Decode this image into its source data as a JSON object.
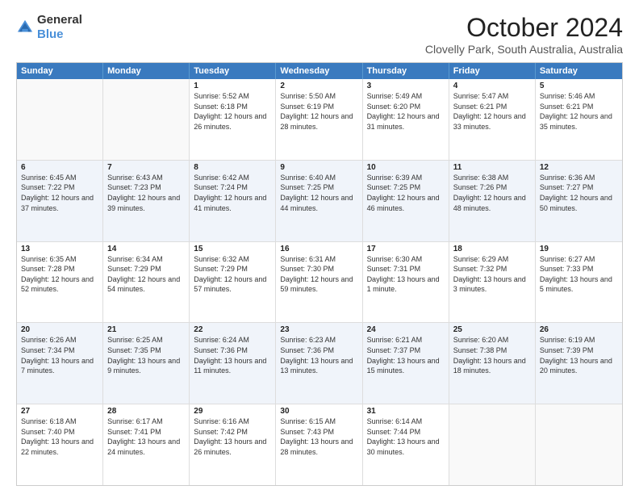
{
  "logo": {
    "general": "General",
    "blue": "Blue"
  },
  "title": "October 2024",
  "subtitle": "Clovelly Park, South Australia, Australia",
  "days": [
    "Sunday",
    "Monday",
    "Tuesday",
    "Wednesday",
    "Thursday",
    "Friday",
    "Saturday"
  ],
  "weeks": [
    [
      {
        "day": "",
        "sunrise": "",
        "sunset": "",
        "daylight": ""
      },
      {
        "day": "",
        "sunrise": "",
        "sunset": "",
        "daylight": ""
      },
      {
        "day": "1",
        "sunrise": "Sunrise: 5:52 AM",
        "sunset": "Sunset: 6:18 PM",
        "daylight": "Daylight: 12 hours and 26 minutes."
      },
      {
        "day": "2",
        "sunrise": "Sunrise: 5:50 AM",
        "sunset": "Sunset: 6:19 PM",
        "daylight": "Daylight: 12 hours and 28 minutes."
      },
      {
        "day": "3",
        "sunrise": "Sunrise: 5:49 AM",
        "sunset": "Sunset: 6:20 PM",
        "daylight": "Daylight: 12 hours and 31 minutes."
      },
      {
        "day": "4",
        "sunrise": "Sunrise: 5:47 AM",
        "sunset": "Sunset: 6:21 PM",
        "daylight": "Daylight: 12 hours and 33 minutes."
      },
      {
        "day": "5",
        "sunrise": "Sunrise: 5:46 AM",
        "sunset": "Sunset: 6:21 PM",
        "daylight": "Daylight: 12 hours and 35 minutes."
      }
    ],
    [
      {
        "day": "6",
        "sunrise": "Sunrise: 6:45 AM",
        "sunset": "Sunset: 7:22 PM",
        "daylight": "Daylight: 12 hours and 37 minutes."
      },
      {
        "day": "7",
        "sunrise": "Sunrise: 6:43 AM",
        "sunset": "Sunset: 7:23 PM",
        "daylight": "Daylight: 12 hours and 39 minutes."
      },
      {
        "day": "8",
        "sunrise": "Sunrise: 6:42 AM",
        "sunset": "Sunset: 7:24 PM",
        "daylight": "Daylight: 12 hours and 41 minutes."
      },
      {
        "day": "9",
        "sunrise": "Sunrise: 6:40 AM",
        "sunset": "Sunset: 7:25 PM",
        "daylight": "Daylight: 12 hours and 44 minutes."
      },
      {
        "day": "10",
        "sunrise": "Sunrise: 6:39 AM",
        "sunset": "Sunset: 7:25 PM",
        "daylight": "Daylight: 12 hours and 46 minutes."
      },
      {
        "day": "11",
        "sunrise": "Sunrise: 6:38 AM",
        "sunset": "Sunset: 7:26 PM",
        "daylight": "Daylight: 12 hours and 48 minutes."
      },
      {
        "day": "12",
        "sunrise": "Sunrise: 6:36 AM",
        "sunset": "Sunset: 7:27 PM",
        "daylight": "Daylight: 12 hours and 50 minutes."
      }
    ],
    [
      {
        "day": "13",
        "sunrise": "Sunrise: 6:35 AM",
        "sunset": "Sunset: 7:28 PM",
        "daylight": "Daylight: 12 hours and 52 minutes."
      },
      {
        "day": "14",
        "sunrise": "Sunrise: 6:34 AM",
        "sunset": "Sunset: 7:29 PM",
        "daylight": "Daylight: 12 hours and 54 minutes."
      },
      {
        "day": "15",
        "sunrise": "Sunrise: 6:32 AM",
        "sunset": "Sunset: 7:29 PM",
        "daylight": "Daylight: 12 hours and 57 minutes."
      },
      {
        "day": "16",
        "sunrise": "Sunrise: 6:31 AM",
        "sunset": "Sunset: 7:30 PM",
        "daylight": "Daylight: 12 hours and 59 minutes."
      },
      {
        "day": "17",
        "sunrise": "Sunrise: 6:30 AM",
        "sunset": "Sunset: 7:31 PM",
        "daylight": "Daylight: 13 hours and 1 minute."
      },
      {
        "day": "18",
        "sunrise": "Sunrise: 6:29 AM",
        "sunset": "Sunset: 7:32 PM",
        "daylight": "Daylight: 13 hours and 3 minutes."
      },
      {
        "day": "19",
        "sunrise": "Sunrise: 6:27 AM",
        "sunset": "Sunset: 7:33 PM",
        "daylight": "Daylight: 13 hours and 5 minutes."
      }
    ],
    [
      {
        "day": "20",
        "sunrise": "Sunrise: 6:26 AM",
        "sunset": "Sunset: 7:34 PM",
        "daylight": "Daylight: 13 hours and 7 minutes."
      },
      {
        "day": "21",
        "sunrise": "Sunrise: 6:25 AM",
        "sunset": "Sunset: 7:35 PM",
        "daylight": "Daylight: 13 hours and 9 minutes."
      },
      {
        "day": "22",
        "sunrise": "Sunrise: 6:24 AM",
        "sunset": "Sunset: 7:36 PM",
        "daylight": "Daylight: 13 hours and 11 minutes."
      },
      {
        "day": "23",
        "sunrise": "Sunrise: 6:23 AM",
        "sunset": "Sunset: 7:36 PM",
        "daylight": "Daylight: 13 hours and 13 minutes."
      },
      {
        "day": "24",
        "sunrise": "Sunrise: 6:21 AM",
        "sunset": "Sunset: 7:37 PM",
        "daylight": "Daylight: 13 hours and 15 minutes."
      },
      {
        "day": "25",
        "sunrise": "Sunrise: 6:20 AM",
        "sunset": "Sunset: 7:38 PM",
        "daylight": "Daylight: 13 hours and 18 minutes."
      },
      {
        "day": "26",
        "sunrise": "Sunrise: 6:19 AM",
        "sunset": "Sunset: 7:39 PM",
        "daylight": "Daylight: 13 hours and 20 minutes."
      }
    ],
    [
      {
        "day": "27",
        "sunrise": "Sunrise: 6:18 AM",
        "sunset": "Sunset: 7:40 PM",
        "daylight": "Daylight: 13 hours and 22 minutes."
      },
      {
        "day": "28",
        "sunrise": "Sunrise: 6:17 AM",
        "sunset": "Sunset: 7:41 PM",
        "daylight": "Daylight: 13 hours and 24 minutes."
      },
      {
        "day": "29",
        "sunrise": "Sunrise: 6:16 AM",
        "sunset": "Sunset: 7:42 PM",
        "daylight": "Daylight: 13 hours and 26 minutes."
      },
      {
        "day": "30",
        "sunrise": "Sunrise: 6:15 AM",
        "sunset": "Sunset: 7:43 PM",
        "daylight": "Daylight: 13 hours and 28 minutes."
      },
      {
        "day": "31",
        "sunrise": "Sunrise: 6:14 AM",
        "sunset": "Sunset: 7:44 PM",
        "daylight": "Daylight: 13 hours and 30 minutes."
      },
      {
        "day": "",
        "sunrise": "",
        "sunset": "",
        "daylight": ""
      },
      {
        "day": "",
        "sunrise": "",
        "sunset": "",
        "daylight": ""
      }
    ]
  ]
}
